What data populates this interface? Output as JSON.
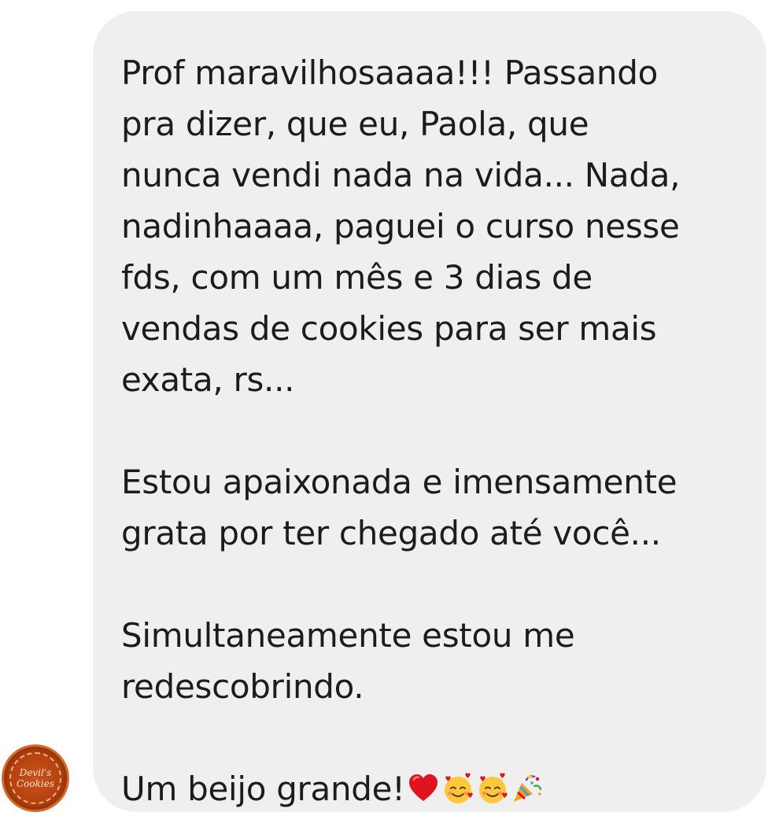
{
  "message": {
    "p1": [
      "Prof maravilhosaaaa!!! Passando",
      "pra dizer, que eu, Paola, que",
      "nunca vendi nada na vida... Nada,",
      "nadinhaaaa, paguei o curso nesse",
      "fds, com um mês e 3 dias de",
      "vendas de cookies para ser mais",
      "exata, rs..."
    ],
    "p2": [
      "Estou apaixonada e imensamente",
      "grata por ter chegado até você..."
    ],
    "p3": [
      "Simultaneamente estou me",
      "redescobrindo."
    ],
    "p4": "Um beijo grande!",
    "p4_icons": [
      "red-heart-icon",
      "smiling-face-with-hearts-icon",
      "smiling-face-with-hearts-icon",
      "party-popper-icon"
    ]
  },
  "avatar": {
    "line1": "Devil's",
    "line2": "Cookies"
  },
  "colors": {
    "bubble": "#efefef",
    "text": "#1c1c1c",
    "heart": "#e0141f"
  }
}
